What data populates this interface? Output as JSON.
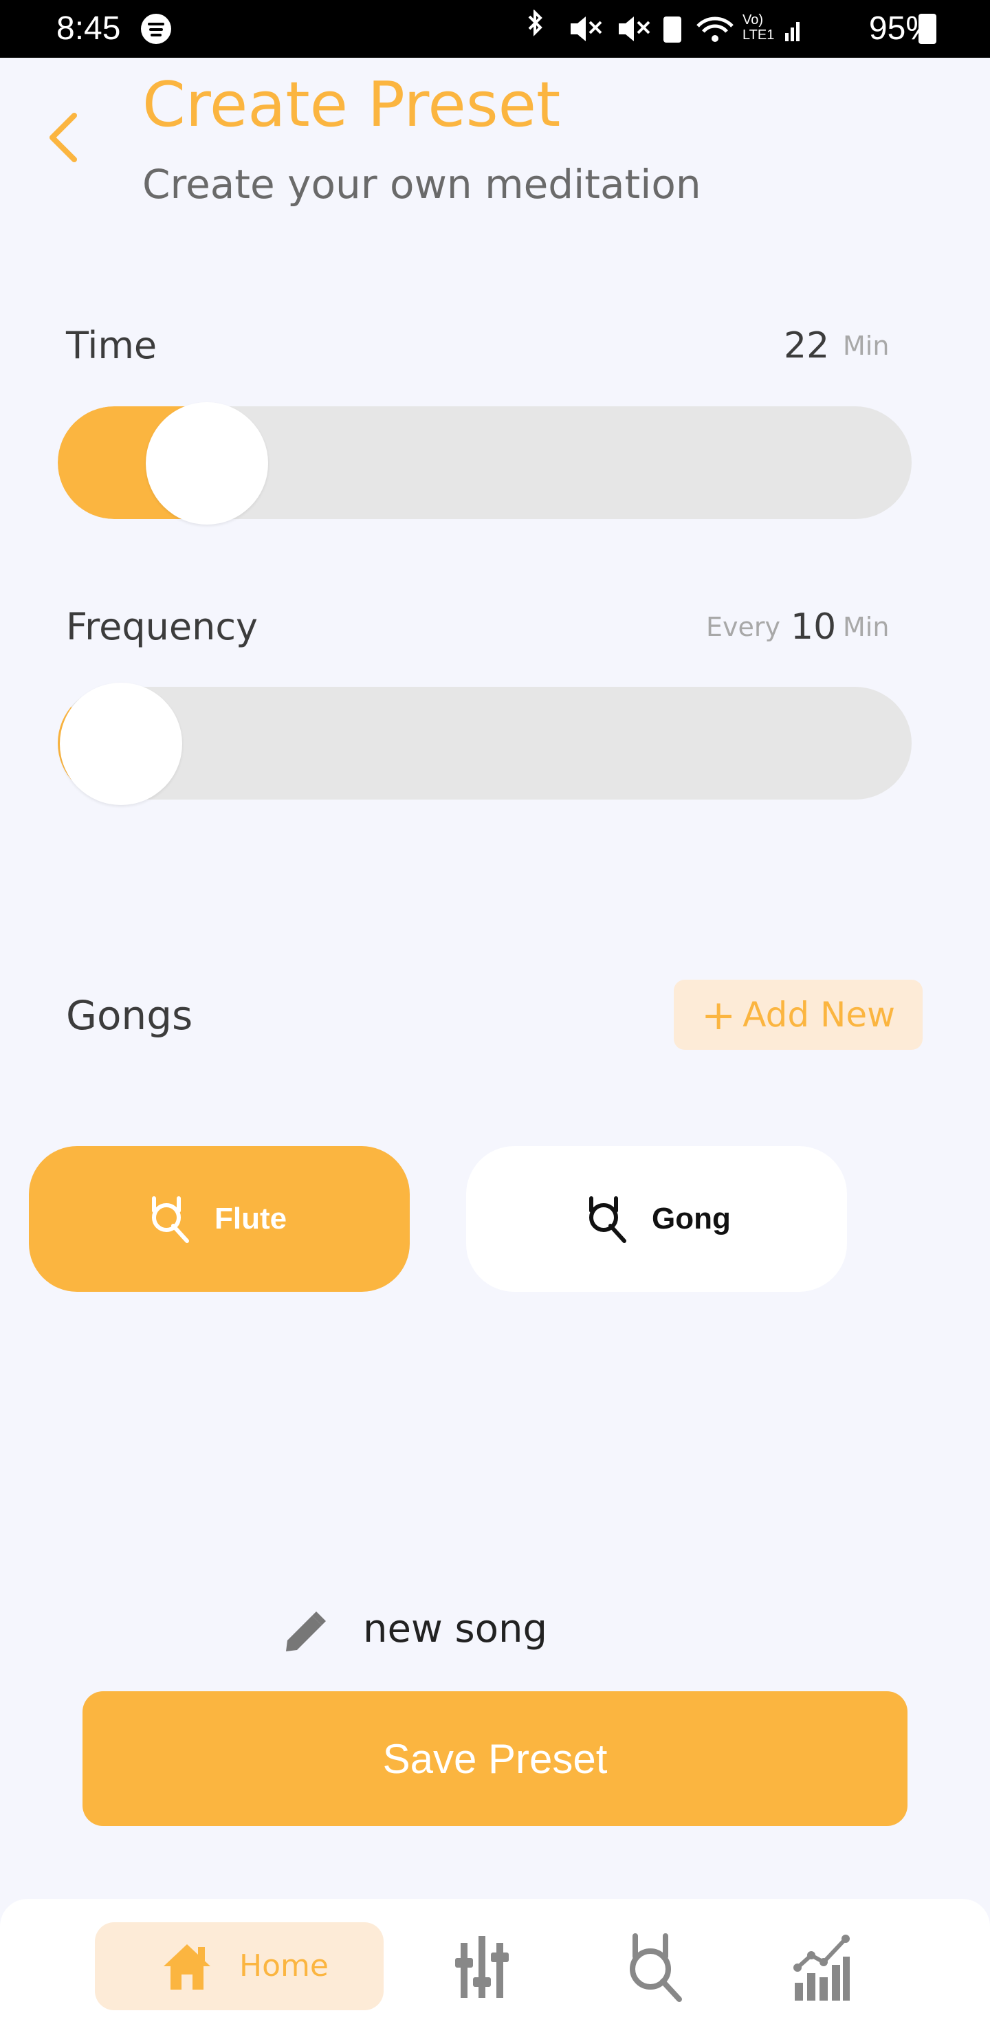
{
  "status_bar": {
    "time": "8:45",
    "icons_text": "✱ ◂× ◂× ▣ ◠",
    "network_text": "Vo) LTE1",
    "battery_percent": "95%"
  },
  "header": {
    "title": "Create Preset",
    "subtitle": "Create your own meditation",
    "back_icon": "chevron-left"
  },
  "time_setting": {
    "label": "Time",
    "value": "22",
    "unit": "Min",
    "slider_level": 0.18
  },
  "frequency_setting": {
    "label": "Frequency",
    "prefix": "Every",
    "value": "10",
    "unit": "Min",
    "slider_level": 0.0
  },
  "gongs": {
    "label": "Gongs",
    "add_new_label": "Add New",
    "items": [
      {
        "label": "Flute",
        "selected": true,
        "icon": "gong-icon"
      },
      {
        "label": "Gong",
        "selected": false,
        "icon": "gong-icon"
      }
    ]
  },
  "preset_name": {
    "value": "new song",
    "icon": "pencil-icon"
  },
  "save_button": {
    "label": "Save Preset"
  },
  "bottom_nav": {
    "items": [
      {
        "label": "Home",
        "icon": "home-icon",
        "active": true
      },
      {
        "label": "",
        "icon": "equalizer-icon",
        "active": false
      },
      {
        "label": "",
        "icon": "gong-icon",
        "active": false
      },
      {
        "label": "",
        "icon": "stats-icon",
        "active": false
      }
    ]
  },
  "colors": {
    "accent": "#fbb540",
    "accent_light": "#fdebd7",
    "background": "#f5f6fd",
    "track": "#e6e6e6"
  }
}
